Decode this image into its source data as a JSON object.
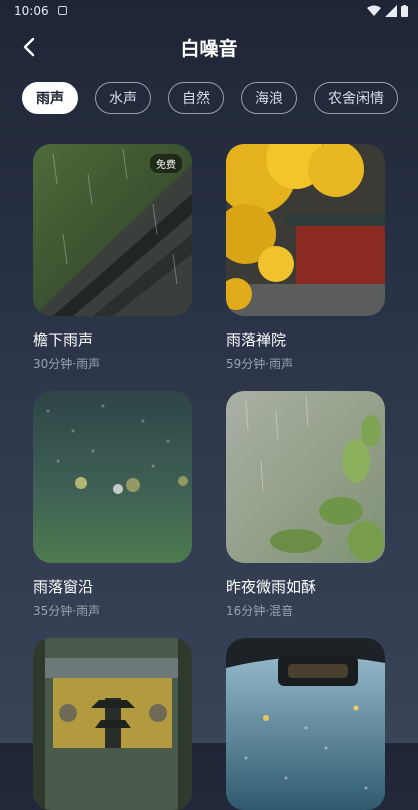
{
  "status_bar": {
    "time": "10:06"
  },
  "header": {
    "title": "白噪音"
  },
  "tabs": [
    {
      "label": "雨声",
      "active": true
    },
    {
      "label": "水声",
      "active": false
    },
    {
      "label": "自然",
      "active": false
    },
    {
      "label": "海浪",
      "active": false
    },
    {
      "label": "农舍闲情",
      "active": false
    }
  ],
  "cards": [
    {
      "title": "檐下雨声",
      "subtitle": "30分钟·雨声",
      "badge": "免费",
      "image": "rain-eaves"
    },
    {
      "title": "雨落禅院",
      "subtitle": "59分钟·雨声",
      "image": "ginkgo-temple"
    },
    {
      "title": "雨落窗沿",
      "subtitle": "35分钟·雨声",
      "image": "rainy-window"
    },
    {
      "title": "昨夜微雨如酥",
      "subtitle": "16分钟·混音",
      "image": "misty-leaves"
    },
    {
      "image": "temple-pagoda"
    },
    {
      "image": "car-windshield"
    }
  ]
}
